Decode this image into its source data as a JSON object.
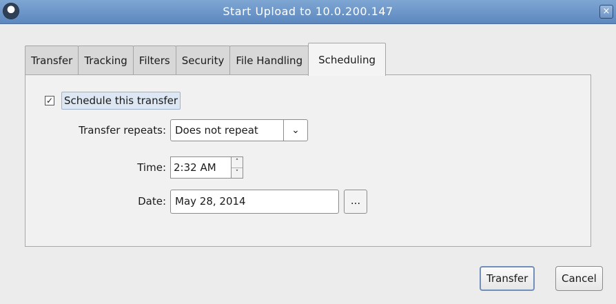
{
  "window": {
    "title": "Start Upload to 10.0.200.147",
    "close_label": "×"
  },
  "tabs": [
    {
      "label": "Transfer"
    },
    {
      "label": "Tracking"
    },
    {
      "label": "Filters"
    },
    {
      "label": "Security"
    },
    {
      "label": "File Handling"
    },
    {
      "label": "Scheduling",
      "active": true
    }
  ],
  "scheduling": {
    "schedule_checkbox": {
      "label": "Schedule this transfer",
      "checked": true,
      "mark": "✓"
    },
    "repeats": {
      "label": "Transfer repeats:",
      "value": "Does not repeat",
      "arrow": "⌄"
    },
    "time": {
      "label": "Time:",
      "value": "2:32 AM",
      "up": "˄",
      "down": "˅"
    },
    "date": {
      "label": "Date:",
      "value": "May 28, 2014",
      "picker_label": "..."
    }
  },
  "buttons": {
    "transfer": "Transfer",
    "cancel": "Cancel"
  },
  "colors": {
    "titlebar": "#6b93c8",
    "accent": "#6f8fb8"
  },
  "icons": {
    "app": "app-logo-icon",
    "close": "close-icon",
    "combo": "chevron-down-icon",
    "spin_up": "chevron-up-icon",
    "spin_down": "chevron-down-icon"
  }
}
